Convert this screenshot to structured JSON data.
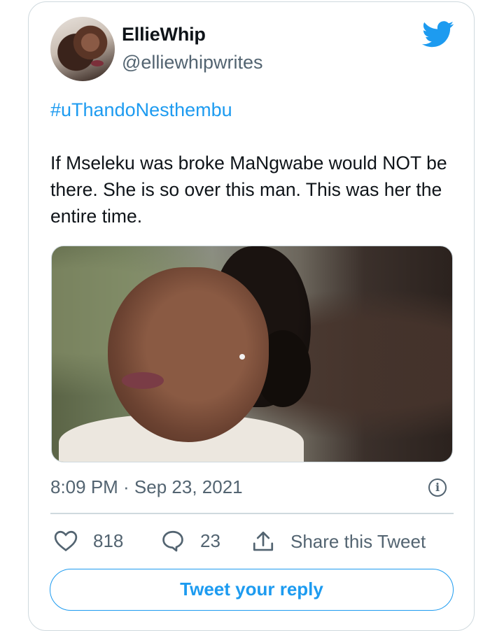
{
  "tweet": {
    "author_name": "EllieWhip",
    "author_handle": "@elliewhipwrites",
    "hashtag": "#uThandoNesthembu",
    "text": "If Mseleku was broke MaNgwabe would NOT be there. She is so over this man. This was her the entire time.",
    "timestamp": "8:09 PM · Sep 23, 2021",
    "likes": "818",
    "replies": "23",
    "share_label": "Share this Tweet",
    "reply_button_label": "Tweet your reply",
    "info_glyph": "i"
  },
  "icons": {
    "brand": "twitter-bird-icon",
    "like": "heart-icon",
    "reply": "speech-bubble-icon",
    "share": "share-upload-icon",
    "info": "info-icon"
  },
  "colors": {
    "accent": "#1d9bf0",
    "text": "#0f1419",
    "secondary_text": "#536471",
    "border": "#cfd9de"
  }
}
